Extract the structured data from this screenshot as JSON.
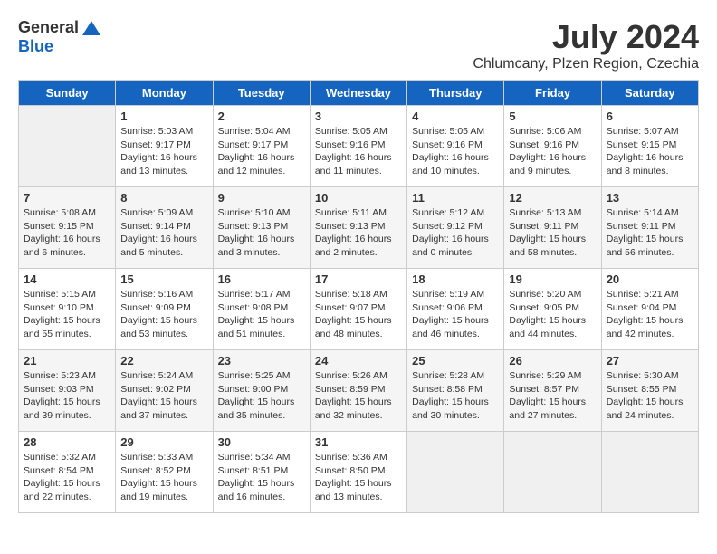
{
  "logo": {
    "text_general": "General",
    "text_blue": "Blue"
  },
  "title": {
    "month_year": "July 2024",
    "location": "Chlumcany, Plzen Region, Czechia"
  },
  "days_of_week": [
    "Sunday",
    "Monday",
    "Tuesday",
    "Wednesday",
    "Thursday",
    "Friday",
    "Saturday"
  ],
  "weeks": [
    [
      {
        "day": "",
        "empty": true
      },
      {
        "day": "1",
        "sunrise": "Sunrise: 5:03 AM",
        "sunset": "Sunset: 9:17 PM",
        "daylight": "Daylight: 16 hours and 13 minutes."
      },
      {
        "day": "2",
        "sunrise": "Sunrise: 5:04 AM",
        "sunset": "Sunset: 9:17 PM",
        "daylight": "Daylight: 16 hours and 12 minutes."
      },
      {
        "day": "3",
        "sunrise": "Sunrise: 5:05 AM",
        "sunset": "Sunset: 9:16 PM",
        "daylight": "Daylight: 16 hours and 11 minutes."
      },
      {
        "day": "4",
        "sunrise": "Sunrise: 5:05 AM",
        "sunset": "Sunset: 9:16 PM",
        "daylight": "Daylight: 16 hours and 10 minutes."
      },
      {
        "day": "5",
        "sunrise": "Sunrise: 5:06 AM",
        "sunset": "Sunset: 9:16 PM",
        "daylight": "Daylight: 16 hours and 9 minutes."
      },
      {
        "day": "6",
        "sunrise": "Sunrise: 5:07 AM",
        "sunset": "Sunset: 9:15 PM",
        "daylight": "Daylight: 16 hours and 8 minutes."
      }
    ],
    [
      {
        "day": "7",
        "sunrise": "Sunrise: 5:08 AM",
        "sunset": "Sunset: 9:15 PM",
        "daylight": "Daylight: 16 hours and 6 minutes."
      },
      {
        "day": "8",
        "sunrise": "Sunrise: 5:09 AM",
        "sunset": "Sunset: 9:14 PM",
        "daylight": "Daylight: 16 hours and 5 minutes."
      },
      {
        "day": "9",
        "sunrise": "Sunrise: 5:10 AM",
        "sunset": "Sunset: 9:13 PM",
        "daylight": "Daylight: 16 hours and 3 minutes."
      },
      {
        "day": "10",
        "sunrise": "Sunrise: 5:11 AM",
        "sunset": "Sunset: 9:13 PM",
        "daylight": "Daylight: 16 hours and 2 minutes."
      },
      {
        "day": "11",
        "sunrise": "Sunrise: 5:12 AM",
        "sunset": "Sunset: 9:12 PM",
        "daylight": "Daylight: 16 hours and 0 minutes."
      },
      {
        "day": "12",
        "sunrise": "Sunrise: 5:13 AM",
        "sunset": "Sunset: 9:11 PM",
        "daylight": "Daylight: 15 hours and 58 minutes."
      },
      {
        "day": "13",
        "sunrise": "Sunrise: 5:14 AM",
        "sunset": "Sunset: 9:11 PM",
        "daylight": "Daylight: 15 hours and 56 minutes."
      }
    ],
    [
      {
        "day": "14",
        "sunrise": "Sunrise: 5:15 AM",
        "sunset": "Sunset: 9:10 PM",
        "daylight": "Daylight: 15 hours and 55 minutes."
      },
      {
        "day": "15",
        "sunrise": "Sunrise: 5:16 AM",
        "sunset": "Sunset: 9:09 PM",
        "daylight": "Daylight: 15 hours and 53 minutes."
      },
      {
        "day": "16",
        "sunrise": "Sunrise: 5:17 AM",
        "sunset": "Sunset: 9:08 PM",
        "daylight": "Daylight: 15 hours and 51 minutes."
      },
      {
        "day": "17",
        "sunrise": "Sunrise: 5:18 AM",
        "sunset": "Sunset: 9:07 PM",
        "daylight": "Daylight: 15 hours and 48 minutes."
      },
      {
        "day": "18",
        "sunrise": "Sunrise: 5:19 AM",
        "sunset": "Sunset: 9:06 PM",
        "daylight": "Daylight: 15 hours and 46 minutes."
      },
      {
        "day": "19",
        "sunrise": "Sunrise: 5:20 AM",
        "sunset": "Sunset: 9:05 PM",
        "daylight": "Daylight: 15 hours and 44 minutes."
      },
      {
        "day": "20",
        "sunrise": "Sunrise: 5:21 AM",
        "sunset": "Sunset: 9:04 PM",
        "daylight": "Daylight: 15 hours and 42 minutes."
      }
    ],
    [
      {
        "day": "21",
        "sunrise": "Sunrise: 5:23 AM",
        "sunset": "Sunset: 9:03 PM",
        "daylight": "Daylight: 15 hours and 39 minutes."
      },
      {
        "day": "22",
        "sunrise": "Sunrise: 5:24 AM",
        "sunset": "Sunset: 9:02 PM",
        "daylight": "Daylight: 15 hours and 37 minutes."
      },
      {
        "day": "23",
        "sunrise": "Sunrise: 5:25 AM",
        "sunset": "Sunset: 9:00 PM",
        "daylight": "Daylight: 15 hours and 35 minutes."
      },
      {
        "day": "24",
        "sunrise": "Sunrise: 5:26 AM",
        "sunset": "Sunset: 8:59 PM",
        "daylight": "Daylight: 15 hours and 32 minutes."
      },
      {
        "day": "25",
        "sunrise": "Sunrise: 5:28 AM",
        "sunset": "Sunset: 8:58 PM",
        "daylight": "Daylight: 15 hours and 30 minutes."
      },
      {
        "day": "26",
        "sunrise": "Sunrise: 5:29 AM",
        "sunset": "Sunset: 8:57 PM",
        "daylight": "Daylight: 15 hours and 27 minutes."
      },
      {
        "day": "27",
        "sunrise": "Sunrise: 5:30 AM",
        "sunset": "Sunset: 8:55 PM",
        "daylight": "Daylight: 15 hours and 24 minutes."
      }
    ],
    [
      {
        "day": "28",
        "sunrise": "Sunrise: 5:32 AM",
        "sunset": "Sunset: 8:54 PM",
        "daylight": "Daylight: 15 hours and 22 minutes."
      },
      {
        "day": "29",
        "sunrise": "Sunrise: 5:33 AM",
        "sunset": "Sunset: 8:52 PM",
        "daylight": "Daylight: 15 hours and 19 minutes."
      },
      {
        "day": "30",
        "sunrise": "Sunrise: 5:34 AM",
        "sunset": "Sunset: 8:51 PM",
        "daylight": "Daylight: 15 hours and 16 minutes."
      },
      {
        "day": "31",
        "sunrise": "Sunrise: 5:36 AM",
        "sunset": "Sunset: 8:50 PM",
        "daylight": "Daylight: 15 hours and 13 minutes."
      },
      {
        "day": "",
        "empty": true
      },
      {
        "day": "",
        "empty": true
      },
      {
        "day": "",
        "empty": true
      }
    ]
  ]
}
